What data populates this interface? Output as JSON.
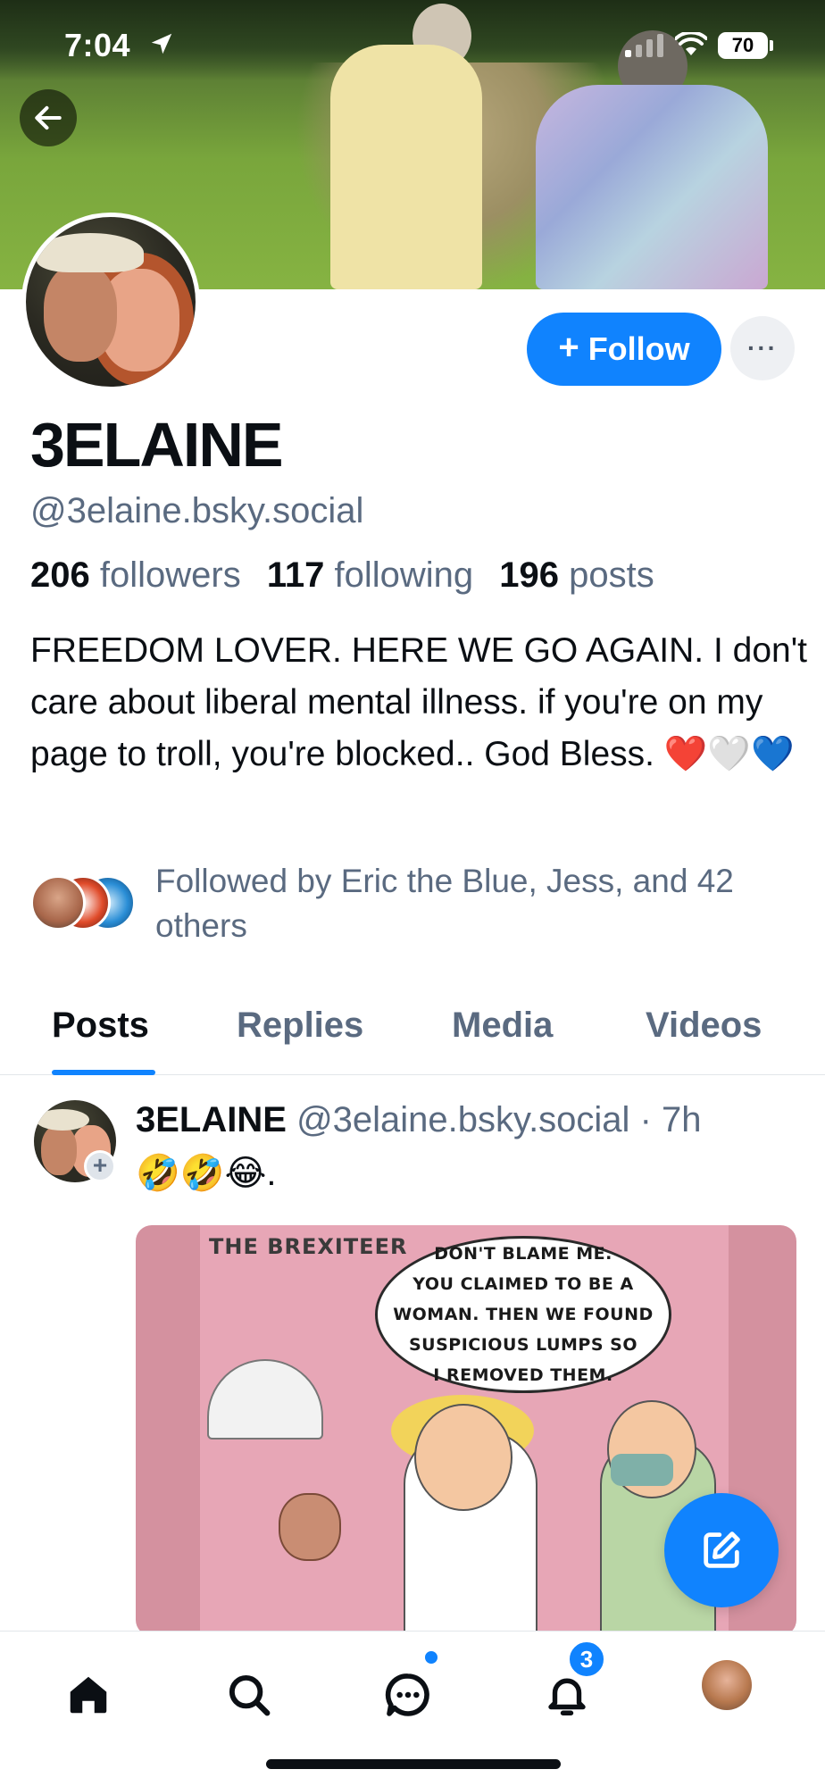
{
  "status_bar": {
    "time": "7:04",
    "battery": "70"
  },
  "profile": {
    "display_name": "3ELAINE",
    "handle": "@3elaine.bsky.social",
    "follow_label": "Follow",
    "more_label": "···",
    "stats": {
      "followers_count": "206",
      "followers_label": "followers",
      "following_count": "117",
      "following_label": "following",
      "posts_count": "196",
      "posts_label": "posts"
    },
    "bio": "FREEDOM LOVER. HERE WE GO AGAIN. I don't care about liberal mental illness. if you're on my page to troll, you're blocked.. God Bless. ❤️🤍💙",
    "followed_by": "Followed by Eric the Blue, Jess, and 42 others"
  },
  "tabs": [
    {
      "label": "Posts",
      "active": true
    },
    {
      "label": "Replies",
      "active": false
    },
    {
      "label": "Media",
      "active": false
    },
    {
      "label": "Videos",
      "active": false
    }
  ],
  "post": {
    "author_name": "3ELAINE",
    "author_handle": "@3elaine.bsky.social",
    "time": "· 7h",
    "text": "🤣🤣😂.",
    "image": {
      "comic_title": "THE BREXITEER",
      "bubble_lines": [
        "DON'T BLAME ME.",
        "YOU CLAIMED TO BE A",
        "WOMAN. THEN WE FOUND",
        "SUSPICIOUS LUMPS SO",
        "I REMOVED THEM."
      ]
    }
  },
  "bottom_nav": {
    "notifications_badge": "3",
    "items": [
      "home-icon",
      "search-icon",
      "chat-icon",
      "bell-icon",
      "profile-avatar"
    ]
  },
  "colors": {
    "accent": "#1083fe",
    "muted_text": "#5a6a80",
    "text": "#0b0f14"
  }
}
